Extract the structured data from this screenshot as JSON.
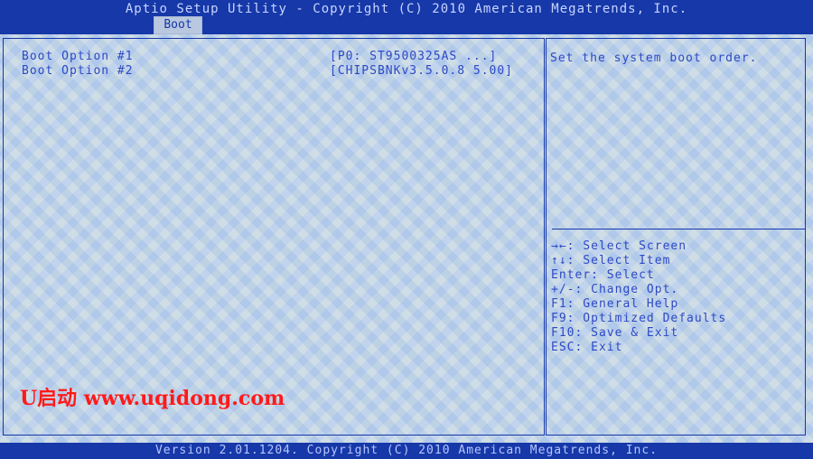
{
  "header": {
    "title": "Aptio Setup Utility - Copyright (C) 2010 American Megatrends, Inc.",
    "tabs": [
      {
        "label": "Boot",
        "active": true
      }
    ]
  },
  "boot_options": [
    {
      "label": "Boot Option #1",
      "value": "[P0: ST9500325AS    ...]"
    },
    {
      "label": "Boot Option #2",
      "value": "[CHIPSBNKv3.5.0.8 5.00]"
    }
  ],
  "help": {
    "description": "Set the system boot order.",
    "keys": [
      {
        "text": "→←: Select Screen"
      },
      {
        "text": "↑↓: Select Item"
      },
      {
        "text": "Enter: Select"
      },
      {
        "text": "+/-: Change Opt."
      },
      {
        "text": "F1: General Help"
      },
      {
        "text": "F9: Optimized Defaults"
      },
      {
        "text": "F10: Save & Exit"
      },
      {
        "text": "ESC: Exit"
      }
    ]
  },
  "watermark": "U启动 www.uqidong.com",
  "footer": {
    "text": "Version 2.01.1204. Copyright (C) 2010 American Megatrends, Inc."
  },
  "colors": {
    "frame_blue": "#1638a8",
    "text_blue": "#2d49c6",
    "watermark_red": "#ff1a1a"
  }
}
